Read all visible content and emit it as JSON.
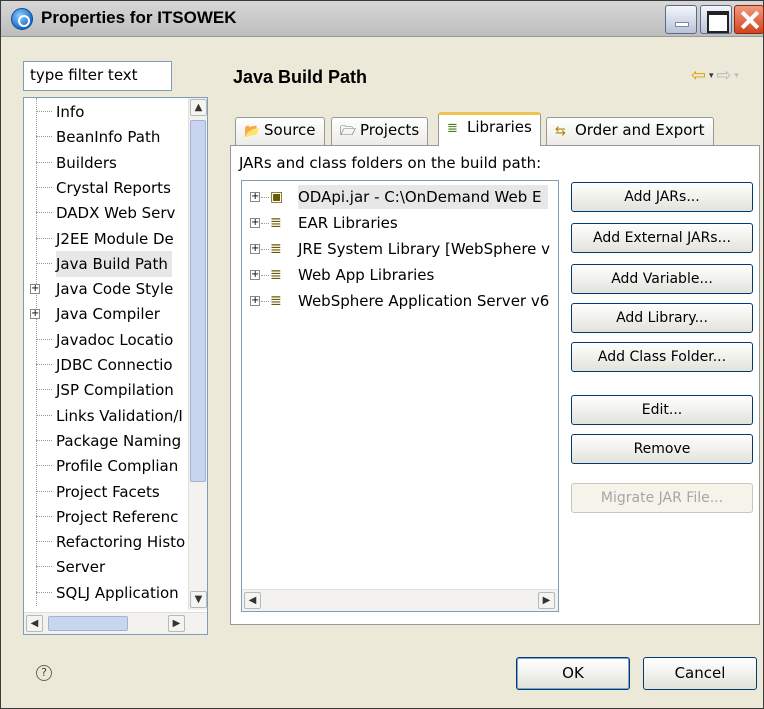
{
  "window": {
    "title": "Properties for ITSOWEK"
  },
  "left": {
    "filter_placeholder": "type filter text",
    "tree": [
      {
        "label": "Info",
        "expandable": false
      },
      {
        "label": "BeanInfo Path",
        "expandable": false
      },
      {
        "label": "Builders",
        "expandable": false
      },
      {
        "label": "Crystal Reports",
        "expandable": false
      },
      {
        "label": "DADX Web Serv",
        "expandable": false
      },
      {
        "label": "J2EE Module De",
        "expandable": false
      },
      {
        "label": "Java Build Path",
        "expandable": false,
        "selected": true
      },
      {
        "label": "Java Code Style",
        "expandable": true
      },
      {
        "label": "Java Compiler",
        "expandable": true
      },
      {
        "label": "Javadoc Locatio",
        "expandable": false
      },
      {
        "label": "JDBC Connectio",
        "expandable": false
      },
      {
        "label": "JSP Compilation",
        "expandable": false
      },
      {
        "label": "Links Validation/I",
        "expandable": false
      },
      {
        "label": "Package Naming",
        "expandable": false
      },
      {
        "label": "Profile Complian",
        "expandable": false
      },
      {
        "label": "Project Facets",
        "expandable": false
      },
      {
        "label": "Project Referenc",
        "expandable": false
      },
      {
        "label": "Refactoring Histo",
        "expandable": false
      },
      {
        "label": "Server",
        "expandable": false
      },
      {
        "label": "SQLJ Application",
        "expandable": false
      }
    ]
  },
  "main": {
    "title": "Java Build Path",
    "tabs": [
      {
        "label": "Source",
        "icon": "source-folder-icon"
      },
      {
        "label": "Projects",
        "icon": "projects-icon"
      },
      {
        "label": "Libraries",
        "icon": "libraries-icon",
        "active": true
      },
      {
        "label": "Order and Export",
        "icon": "order-export-icon"
      }
    ],
    "panel_label": "JARs and class folders on the build path:",
    "entries": [
      {
        "label": "ODApi.jar - C:\\OnDemand Web E",
        "icon": "jar-icon",
        "selected": true
      },
      {
        "label": "EAR Libraries",
        "icon": "library-icon"
      },
      {
        "label": "JRE System Library [WebSphere v",
        "icon": "library-icon"
      },
      {
        "label": "Web App Libraries",
        "icon": "library-icon"
      },
      {
        "label": "WebSphere Application Server v6",
        "icon": "library-icon"
      }
    ],
    "buttons": [
      {
        "label": "Add JARs...",
        "enabled": true
      },
      {
        "label": "Add External JARs...",
        "enabled": true
      },
      {
        "label": "Add Variable...",
        "enabled": true
      },
      {
        "label": "Add Library...",
        "enabled": true
      },
      {
        "label": "Add Class Folder...",
        "enabled": true
      },
      {
        "label": "Edit...",
        "enabled": true
      },
      {
        "label": "Remove",
        "enabled": true
      },
      {
        "label": "Migrate JAR File...",
        "enabled": false
      }
    ]
  },
  "footer": {
    "ok_label": "OK",
    "cancel_label": "Cancel"
  }
}
